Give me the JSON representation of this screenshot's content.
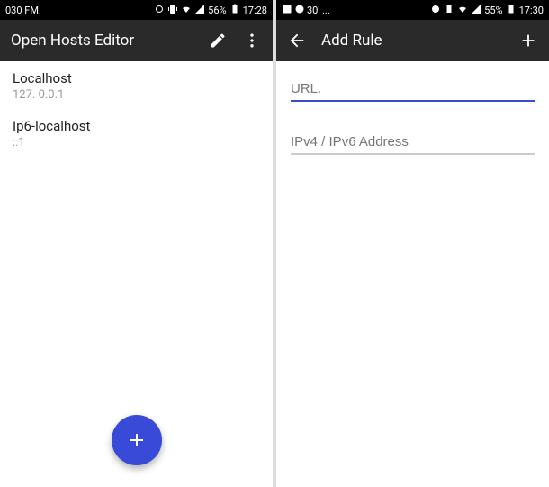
{
  "left": {
    "status": {
      "left_text": "030 FM.",
      "battery": "56%",
      "time": "17:28"
    },
    "appbar": {
      "title": "Open Hosts Editor"
    },
    "hosts": [
      {
        "name": "Localhost",
        "ip": "127. 0.0.1"
      },
      {
        "name": "Ip6-localhost",
        "ip": "::1"
      }
    ]
  },
  "right": {
    "status": {
      "left_text": "30' ...",
      "battery": "55%",
      "time": "17:30"
    },
    "appbar": {
      "title": "Add Rule"
    },
    "fields": {
      "url_placeholder": "URL.",
      "ip_placeholder": "IPv4 / IPv6 Address"
    }
  }
}
